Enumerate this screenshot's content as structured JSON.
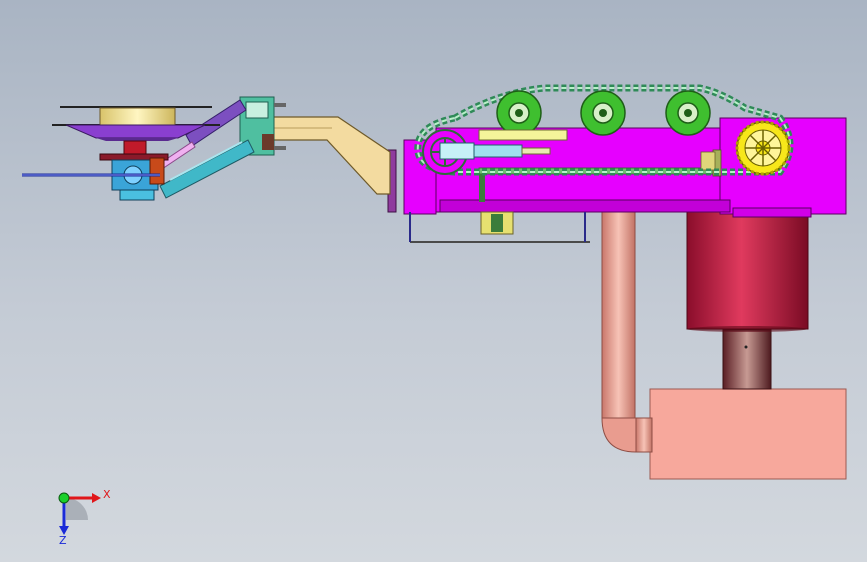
{
  "triad": {
    "x_label": "X",
    "z_label": "Z"
  }
}
